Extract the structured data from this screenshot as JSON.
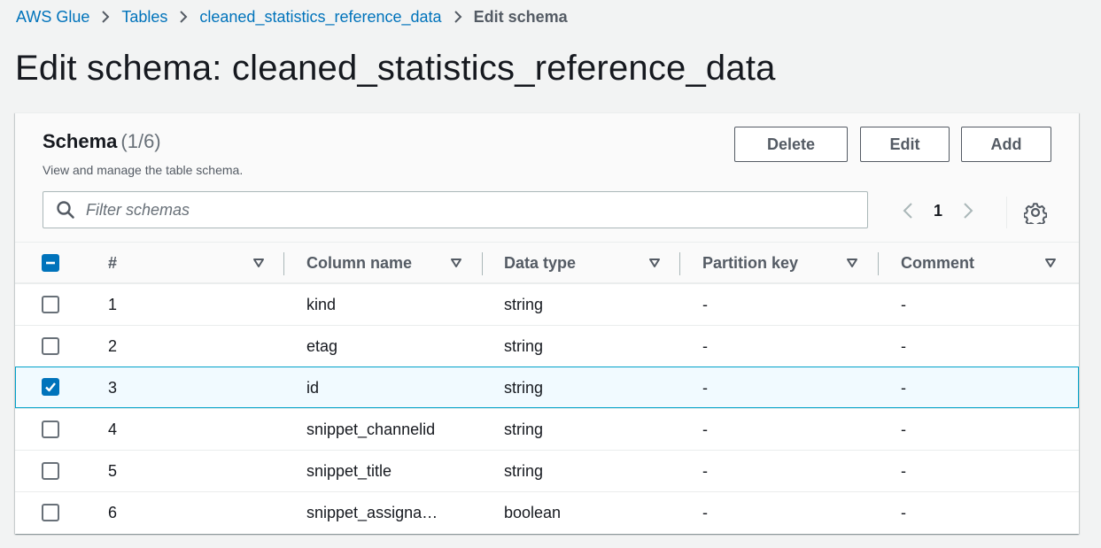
{
  "breadcrumb": [
    {
      "label": "AWS Glue"
    },
    {
      "label": "Tables"
    },
    {
      "label": "cleaned_statistics_reference_data"
    },
    {
      "label": "Edit schema"
    }
  ],
  "page_title": "Edit schema: cleaned_statistics_reference_data",
  "panel": {
    "title": "Schema",
    "count": "(1/6)",
    "description": "View and manage the table schema.",
    "buttons": {
      "delete": "Delete",
      "edit": "Edit",
      "add": "Add"
    },
    "filter_placeholder": "Filter schemas",
    "current_page": "1"
  },
  "table": {
    "columns": [
      "#",
      "Column name",
      "Data type",
      "Partition key",
      "Comment"
    ],
    "header_checkbox": "indeterminate",
    "rows": [
      {
        "num": "1",
        "name": "kind",
        "type": "string",
        "partition": "-",
        "comment": "-",
        "checked": false
      },
      {
        "num": "2",
        "name": "etag",
        "type": "string",
        "partition": "-",
        "comment": "-",
        "checked": false
      },
      {
        "num": "3",
        "name": "id",
        "type": "string",
        "partition": "-",
        "comment": "-",
        "checked": true
      },
      {
        "num": "4",
        "name": "snippet_channelid",
        "type": "string",
        "partition": "-",
        "comment": "-",
        "checked": false
      },
      {
        "num": "5",
        "name": "snippet_title",
        "type": "string",
        "partition": "-",
        "comment": "-",
        "checked": false
      },
      {
        "num": "6",
        "name": "snippet_assigna…",
        "type": "boolean",
        "partition": "-",
        "comment": "-",
        "checked": false
      }
    ]
  },
  "icons": {
    "breadcrumb_separator": "chevron-right-icon",
    "search": "search-icon",
    "prev": "chevron-left-icon",
    "next": "chevron-right-icon",
    "settings": "gear-icon",
    "sort": "caret-down-icon"
  },
  "colors": {
    "link": "#0073bb",
    "selected_row_bg": "#f1faff",
    "selected_row_border": "#00a1c9",
    "checkbox_checked": "#0073bb"
  }
}
